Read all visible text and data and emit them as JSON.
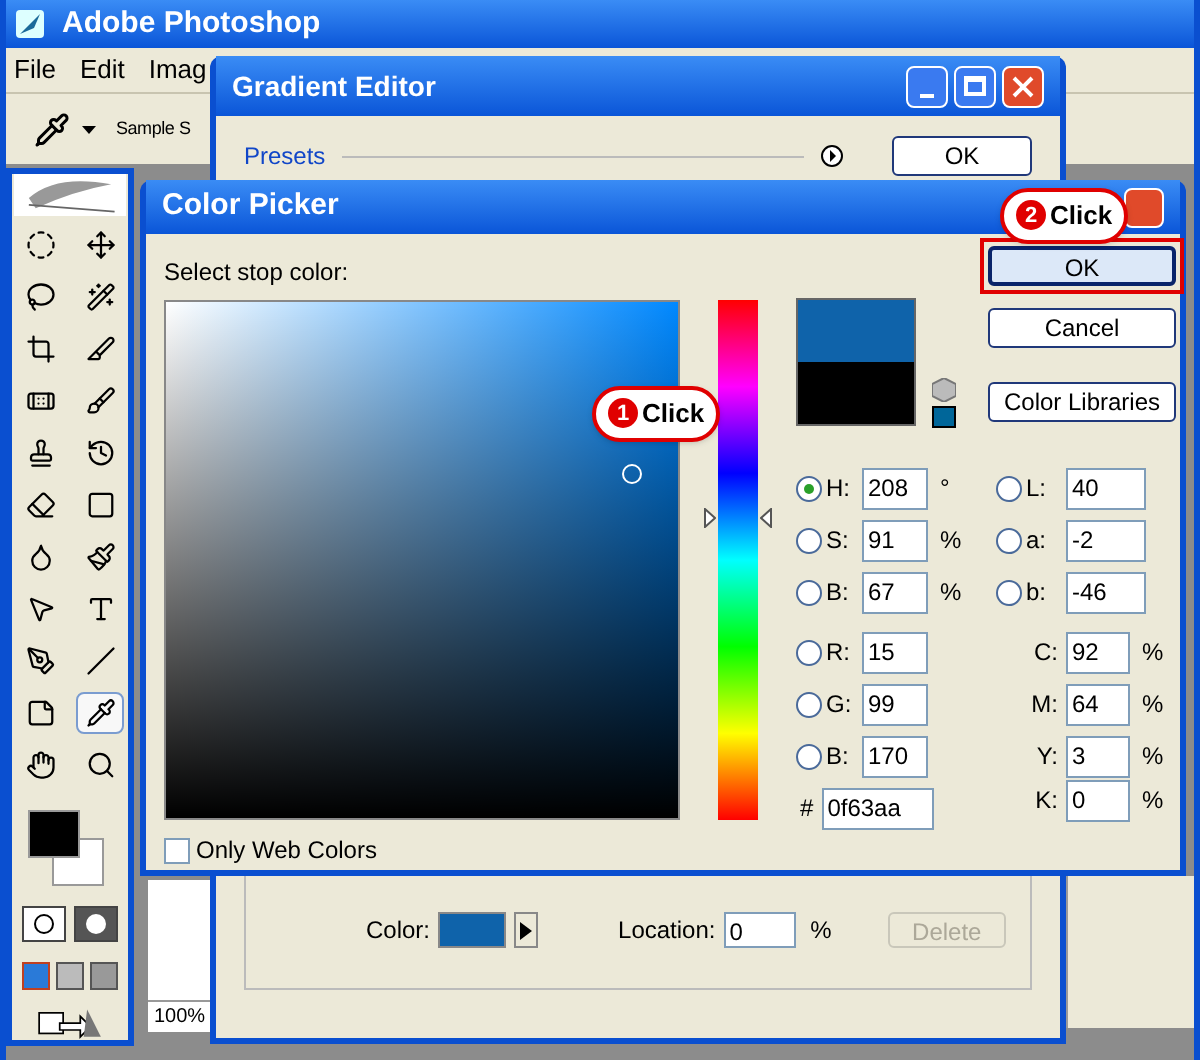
{
  "app": {
    "title": "Adobe Photoshop",
    "menu": [
      "File",
      "Edit",
      "Imag"
    ],
    "options_label": "Sample S",
    "zoom": "100%"
  },
  "tools": [
    {
      "kind": "marquee",
      "selected": false
    },
    {
      "kind": "move",
      "selected": false
    },
    {
      "kind": "lasso",
      "selected": false
    },
    {
      "kind": "wand",
      "selected": false
    },
    {
      "kind": "crop",
      "selected": false
    },
    {
      "kind": "slice",
      "selected": false
    },
    {
      "kind": "heal",
      "selected": false
    },
    {
      "kind": "brush",
      "selected": false
    },
    {
      "kind": "stamp",
      "selected": false
    },
    {
      "kind": "history",
      "selected": false
    },
    {
      "kind": "eraser",
      "selected": false
    },
    {
      "kind": "gradient",
      "selected": false
    },
    {
      "kind": "blur",
      "selected": false
    },
    {
      "kind": "dodge",
      "selected": false
    },
    {
      "kind": "select",
      "selected": false
    },
    {
      "kind": "type",
      "selected": false
    },
    {
      "kind": "pen",
      "selected": false
    },
    {
      "kind": "line",
      "selected": false
    },
    {
      "kind": "notes",
      "selected": false
    },
    {
      "kind": "eyedropper",
      "selected": true
    },
    {
      "kind": "hand",
      "selected": false
    },
    {
      "kind": "zoom",
      "selected": false
    }
  ],
  "gradient_editor": {
    "title": "Gradient Editor",
    "presets_label": "Presets",
    "ok": "OK",
    "color_label": "Color:",
    "location_label": "Location:",
    "location": "0",
    "unit": "%",
    "delete": "Delete",
    "delete_disabled": true
  },
  "color_picker": {
    "title": "Color Picker",
    "prompt": "Select stop color:",
    "buttons": [
      {
        "label": "OK",
        "highlighted": true
      },
      {
        "label": "Cancel",
        "highlighted": false
      },
      {
        "label": "Color Libraries",
        "highlighted": false
      }
    ],
    "hue_slider": {
      "level": 0.58
    },
    "left_fields": [
      {
        "label": "H:",
        "value": "208",
        "unit": "°",
        "selected": true
      },
      {
        "label": "S:",
        "value": "91",
        "unit": "%",
        "selected": false
      },
      {
        "label": "B:",
        "value": "67",
        "unit": "%",
        "selected": false
      },
      {
        "label": "R:",
        "value": "15",
        "selected": false
      },
      {
        "label": "G:",
        "value": "99",
        "selected": false
      },
      {
        "label": "B:",
        "value": "170",
        "selected": false
      }
    ],
    "right_fields": [
      {
        "kind": "radio",
        "label": "L:",
        "value": "40",
        "selected": false
      },
      {
        "kind": "radio",
        "label": "a:",
        "value": "-2",
        "selected": false
      },
      {
        "kind": "radio",
        "label": "b:",
        "value": "-46",
        "selected": false
      },
      {
        "kind": "plain",
        "label": "C:",
        "value": "92",
        "unit": "%"
      },
      {
        "kind": "plain",
        "label": "M:",
        "value": "64",
        "unit": "%"
      },
      {
        "kind": "plain",
        "label": "Y:",
        "value": "3",
        "unit": "%"
      },
      {
        "kind": "plain",
        "label": "K:",
        "value": "0",
        "unit": "%"
      }
    ],
    "hex_label": "#",
    "hex": "0f63aa",
    "web_colors": {
      "label": "Only Web Colors",
      "checked": false
    }
  },
  "callouts": [
    {
      "number": "1",
      "text": "Click"
    },
    {
      "number": "2",
      "text": "Click"
    }
  ]
}
